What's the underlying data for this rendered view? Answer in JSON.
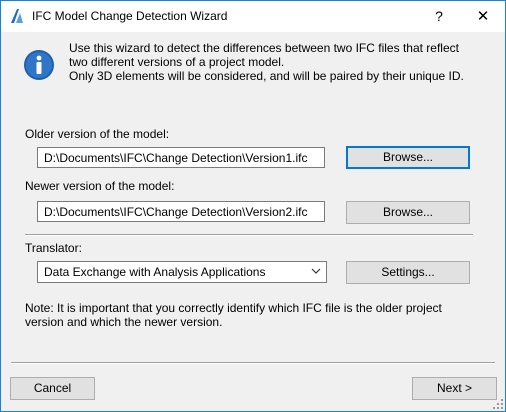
{
  "window": {
    "title": "IFC Model Change Detection Wizard",
    "help_glyph": "?",
    "close_glyph": "✕"
  },
  "intro": {
    "line1": "Use this wizard to detect the differences between two IFC files that reflect",
    "line2": "two different versions of a project model.",
    "line3": "Only 3D elements will be considered, and will be paired by their unique ID."
  },
  "older": {
    "label": "Older version of the model:",
    "value": "D:\\Documents\\IFC\\Change Detection\\Version1.ifc",
    "browse_label": "Browse..."
  },
  "newer": {
    "label": "Newer version of the model:",
    "value": "D:\\Documents\\IFC\\Change Detection\\Version2.ifc",
    "browse_label": "Browse..."
  },
  "translator": {
    "label": "Translator:",
    "selected": "Data Exchange with Analysis Applications",
    "settings_label": "Settings..."
  },
  "note": {
    "line1": "Note: It is important that you correctly identify which IFC file is the older project",
    "line2": "version and which the newer version."
  },
  "footer": {
    "cancel_label": "Cancel",
    "next_label": "Next >"
  },
  "colors": {
    "accent": "#0078d7",
    "info_icon": "#1f5fae",
    "app_icon": "#1f6fc5"
  }
}
